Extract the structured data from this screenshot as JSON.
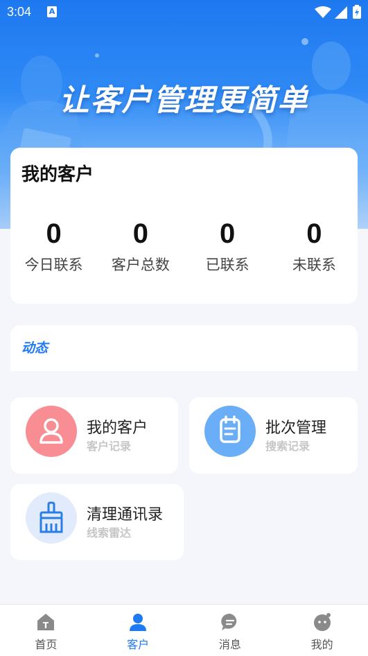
{
  "status_bar": {
    "time": "3:04"
  },
  "banner": {
    "slogan": "让客户管理更简单"
  },
  "my_customers": {
    "title": "我的客户",
    "stats": [
      {
        "value": "0",
        "label": "今日联系"
      },
      {
        "value": "0",
        "label": "客户总数"
      },
      {
        "value": "0",
        "label": "已联系"
      },
      {
        "value": "0",
        "label": "未联系"
      }
    ]
  },
  "dynamic": {
    "label": "动态"
  },
  "tiles": [
    {
      "title": "我的客户",
      "subtitle": "客户记录",
      "icon": "person-icon",
      "color": "#f88d93"
    },
    {
      "title": "批次管理",
      "subtitle": "搜索记录",
      "icon": "notepad-icon",
      "color": "#6aaef7"
    },
    {
      "title": "清理通讯录",
      "subtitle": "线索雷达",
      "icon": "brush-icon",
      "color": "#e1ebfb"
    }
  ],
  "tabbar": {
    "items": [
      {
        "label": "首页",
        "icon": "home-icon"
      },
      {
        "label": "客户",
        "icon": "customer-icon"
      },
      {
        "label": "消息",
        "icon": "message-icon"
      },
      {
        "label": "我的",
        "icon": "profile-icon"
      }
    ],
    "active_color": "#1f79f0",
    "inactive_color": "#8a8a8a"
  }
}
